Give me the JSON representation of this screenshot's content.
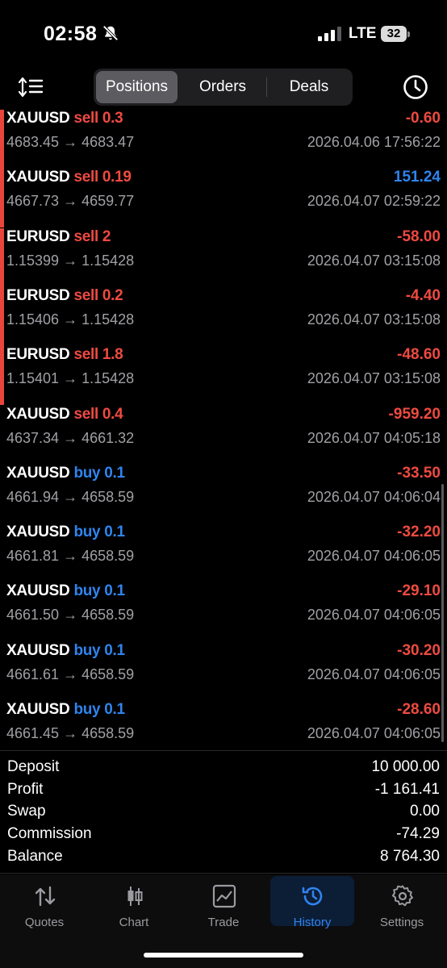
{
  "status_bar": {
    "time": "02:58",
    "network": "LTE",
    "battery": "32"
  },
  "toolbar": {
    "tabs": [
      {
        "label": "Positions",
        "active": true
      },
      {
        "label": "Orders",
        "active": false
      },
      {
        "label": "Deals",
        "active": false
      }
    ]
  },
  "positions": [
    {
      "symbol": "XAUUSD",
      "side": "sell 0.3",
      "side_type": "sell",
      "profit": "-0.60",
      "profit_sign": "neg",
      "open": "4683.45",
      "close": "4683.47",
      "time": "2026.04.06 17:56:22",
      "highlight": true
    },
    {
      "symbol": "XAUUSD",
      "side": "sell 0.19",
      "side_type": "sell",
      "profit": "151.24",
      "profit_sign": "pos",
      "open": "4667.73",
      "close": "4659.77",
      "time": "2026.04.07 02:59:22",
      "highlight": true
    },
    {
      "symbol": "EURUSD",
      "side": "sell 2",
      "side_type": "sell",
      "profit": "-58.00",
      "profit_sign": "neg",
      "open": "1.15399",
      "close": "1.15428",
      "time": "2026.04.07 03:15:08",
      "highlight": true
    },
    {
      "symbol": "EURUSD",
      "side": "sell 0.2",
      "side_type": "sell",
      "profit": "-4.40",
      "profit_sign": "neg",
      "open": "1.15406",
      "close": "1.15428",
      "time": "2026.04.07 03:15:08",
      "highlight": true
    },
    {
      "symbol": "EURUSD",
      "side": "sell 1.8",
      "side_type": "sell",
      "profit": "-48.60",
      "profit_sign": "neg",
      "open": "1.15401",
      "close": "1.15428",
      "time": "2026.04.07 03:15:08",
      "highlight": true
    },
    {
      "symbol": "XAUUSD",
      "side": "sell 0.4",
      "side_type": "sell",
      "profit": "-959.20",
      "profit_sign": "neg",
      "open": "4637.34",
      "close": "4661.32",
      "time": "2026.04.07 04:05:18",
      "highlight": false
    },
    {
      "symbol": "XAUUSD",
      "side": "buy 0.1",
      "side_type": "buy",
      "profit": "-33.50",
      "profit_sign": "neg",
      "open": "4661.94",
      "close": "4658.59",
      "time": "2026.04.07 04:06:04",
      "highlight": false
    },
    {
      "symbol": "XAUUSD",
      "side": "buy 0.1",
      "side_type": "buy",
      "profit": "-32.20",
      "profit_sign": "neg",
      "open": "4661.81",
      "close": "4658.59",
      "time": "2026.04.07 04:06:05",
      "highlight": false
    },
    {
      "symbol": "XAUUSD",
      "side": "buy 0.1",
      "side_type": "buy",
      "profit": "-29.10",
      "profit_sign": "neg",
      "open": "4661.50",
      "close": "4658.59",
      "time": "2026.04.07 04:06:05",
      "highlight": false
    },
    {
      "symbol": "XAUUSD",
      "side": "buy 0.1",
      "side_type": "buy",
      "profit": "-30.20",
      "profit_sign": "neg",
      "open": "4661.61",
      "close": "4658.59",
      "time": "2026.04.07 04:06:05",
      "highlight": false
    },
    {
      "symbol": "XAUUSD",
      "side": "buy 0.1",
      "side_type": "buy",
      "profit": "-28.60",
      "profit_sign": "neg",
      "open": "4661.45",
      "close": "4658.59",
      "time": "2026.04.07 04:06:05",
      "highlight": false
    }
  ],
  "summary": [
    {
      "label": "Deposit",
      "value": "10 000.00"
    },
    {
      "label": "Profit",
      "value": "-1 161.41"
    },
    {
      "label": "Swap",
      "value": "0.00"
    },
    {
      "label": "Commission",
      "value": "-74.29"
    },
    {
      "label": "Balance",
      "value": "8 764.30"
    }
  ],
  "tabbar": [
    {
      "label": "Quotes",
      "icon": "quotes-icon",
      "active": false
    },
    {
      "label": "Chart",
      "icon": "chart-icon",
      "active": false
    },
    {
      "label": "Trade",
      "icon": "trade-icon",
      "active": false
    },
    {
      "label": "History",
      "icon": "history-icon",
      "active": true
    },
    {
      "label": "Settings",
      "icon": "settings-icon",
      "active": false
    }
  ],
  "colors": {
    "sell": "#ef4a41",
    "buy": "#2f84ee",
    "accent_bar": "#e8453c",
    "active_tab": "#2f84ee"
  }
}
